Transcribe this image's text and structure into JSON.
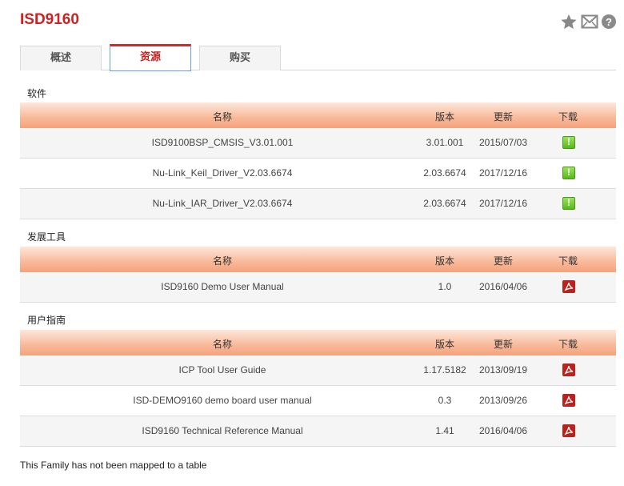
{
  "title": "ISD9160",
  "icons": {
    "star": "star-icon",
    "mail": "mail-icon",
    "help": "help-icon"
  },
  "help_glyph": "?",
  "tabs": [
    {
      "label": "概述"
    },
    {
      "label": "资源"
    },
    {
      "label": "购买"
    }
  ],
  "headers": {
    "name": "名称",
    "version": "版本",
    "date": "更新",
    "download": "下载"
  },
  "sections": [
    {
      "label": "软件",
      "rows": [
        {
          "name": "ISD9100BSP_CMSIS_V3.01.001",
          "version": "3.01.001",
          "date": "2015/07/03",
          "icon": "zip-download-icon"
        },
        {
          "name": "Nu-Link_Keil_Driver_V2.03.6674",
          "version": "2.03.6674",
          "date": "2017/12/16",
          "icon": "zip-download-icon"
        },
        {
          "name": "Nu-Link_IAR_Driver_V2.03.6674",
          "version": "2.03.6674",
          "date": "2017/12/16",
          "icon": "zip-download-icon"
        }
      ]
    },
    {
      "label": "发展工具",
      "rows": [
        {
          "name": "ISD9160 Demo User Manual",
          "version": "1.0",
          "date": "2016/04/06",
          "icon": "pdf-icon"
        }
      ]
    },
    {
      "label": "用户指南",
      "rows": [
        {
          "name": "ICP Tool User Guide",
          "version": "1.17.5182",
          "date": "2013/09/19",
          "icon": "pdf-icon"
        },
        {
          "name": "ISD-DEMO9160 demo board user manual",
          "version": "0.3",
          "date": "2013/09/26",
          "icon": "pdf-icon"
        },
        {
          "name": "ISD9160 Technical Reference Manual",
          "version": "1.41",
          "date": "2016/04/06",
          "icon": "pdf-icon"
        }
      ]
    }
  ],
  "footer": "This Family has not been mapped to a table",
  "colors": {
    "title": "#cc2222",
    "active_tab_border": "#d02b2b",
    "header_gradient_end": "#f4a27d"
  }
}
